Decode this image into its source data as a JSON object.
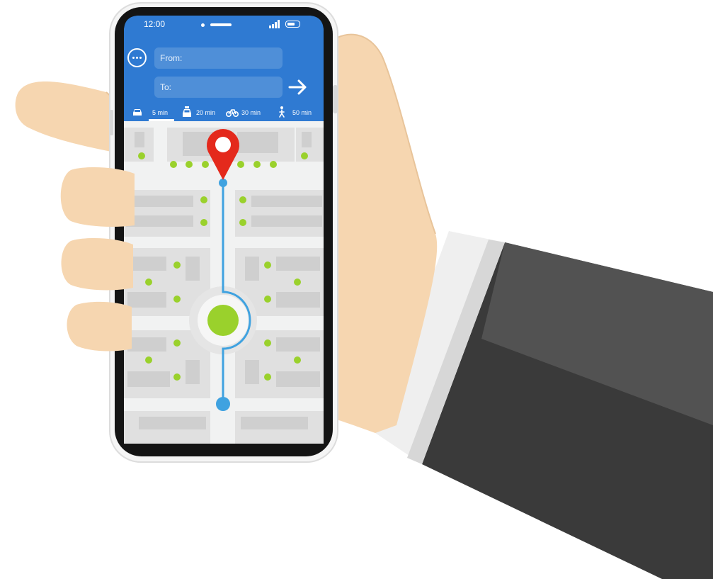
{
  "status_bar": {
    "time": "12:00"
  },
  "route_form": {
    "from_label": "From:",
    "to_label": "To:"
  },
  "travel_modes": [
    {
      "icon": "car-icon",
      "time": "5 min",
      "active": true
    },
    {
      "icon": "taxi-icon",
      "time": "20 min",
      "active": false
    },
    {
      "icon": "bicycle-icon",
      "time": "30 min",
      "active": false
    },
    {
      "icon": "walking-icon",
      "time": "50 min",
      "active": false
    }
  ],
  "colors": {
    "header_blue": "#2f7ad2",
    "input_blue": "#4f8fd8",
    "route_blue": "#3fa2e0",
    "pin_red": "#e4291c",
    "tree_green": "#9ad12c",
    "map_bg": "#f1f2f2",
    "block_gray": "#d4d4d4",
    "skin": "#f6d6b0",
    "suit": "#3a3a3a"
  }
}
